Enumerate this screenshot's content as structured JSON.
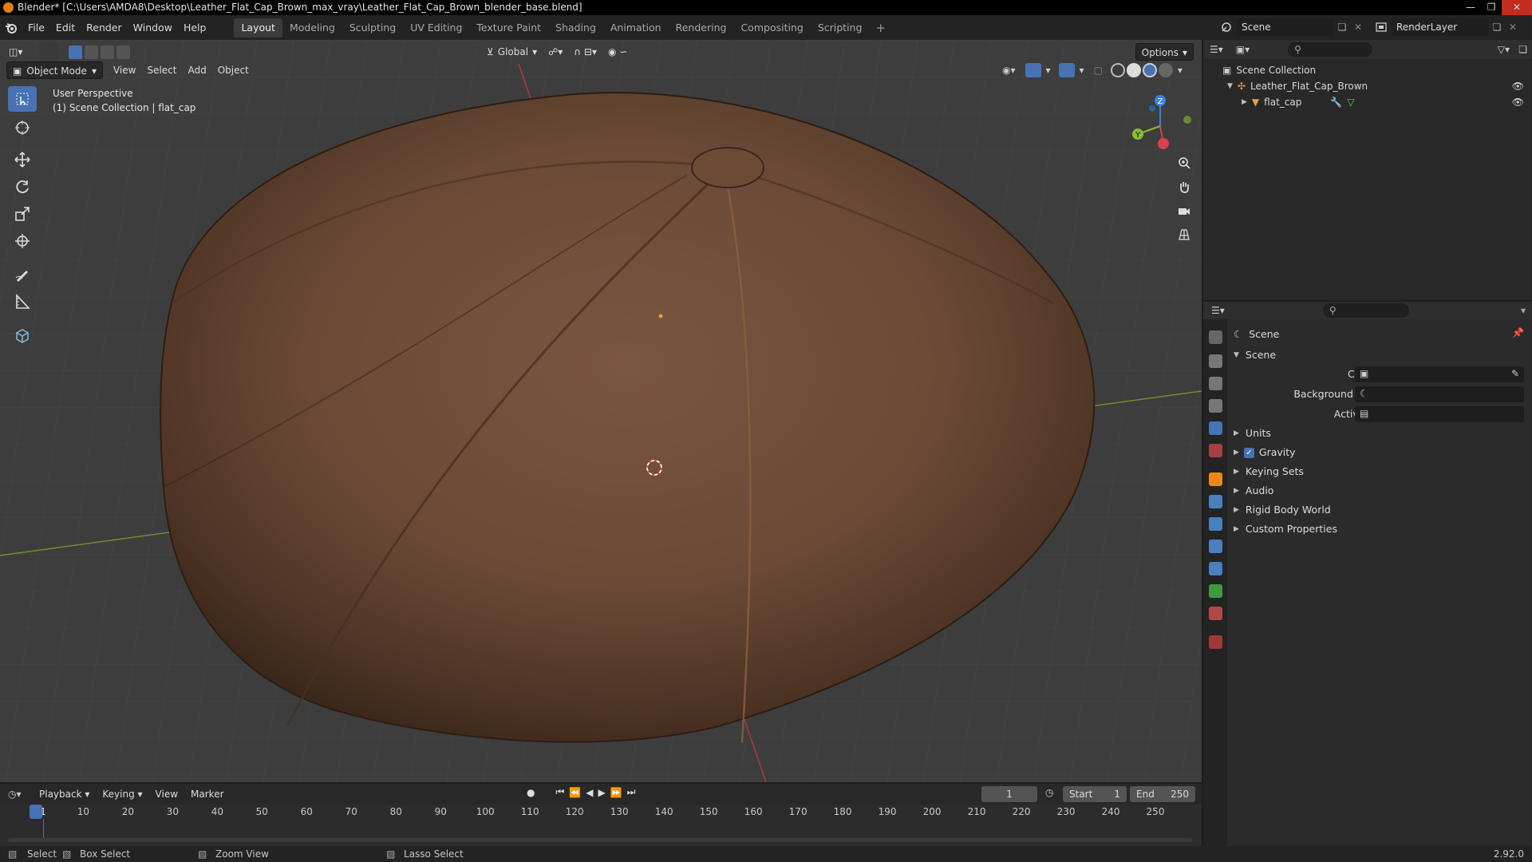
{
  "window": {
    "title": "Blender* [C:\\Users\\AMDA8\\Desktop\\Leather_Flat_Cap_Brown_max_vray\\Leather_Flat_Cap_Brown_blender_base.blend]"
  },
  "menu": [
    "File",
    "Edit",
    "Render",
    "Window",
    "Help"
  ],
  "workspaces": [
    "Layout",
    "Modeling",
    "Sculpting",
    "UV Editing",
    "Texture Paint",
    "Shading",
    "Animation",
    "Rendering",
    "Compositing",
    "Scripting"
  ],
  "workspace_add": "+",
  "scene_selector": {
    "scene": "Scene",
    "view_layer": "RenderLayer"
  },
  "viewport": {
    "mode": "Object Mode",
    "menus": [
      "View",
      "Select",
      "Add",
      "Object"
    ],
    "orientation": "Global",
    "options_label": "Options",
    "overlay_line1": "User Perspective",
    "overlay_line2": "(1) Scene Collection | flat_cap",
    "gizmo": {
      "x": "X",
      "y": "Y",
      "z": "Z"
    }
  },
  "outliner": {
    "root": "Scene Collection",
    "collection": "Leather_Flat_Cap_Brown",
    "object": "flat_cap"
  },
  "properties": {
    "header": "Scene",
    "panel": "Scene",
    "fields": [
      {
        "label": "Camera",
        "value": ""
      },
      {
        "label": "Background Scene",
        "value": ""
      },
      {
        "label": "Active Clip",
        "value": ""
      }
    ],
    "subpanels": [
      "Units",
      "Gravity",
      "Keying Sets",
      "Audio",
      "Rigid Body World",
      "Custom Properties"
    ],
    "gravity_checked": true
  },
  "timeline": {
    "menus": [
      "Playback",
      "Keying",
      "View",
      "Marker"
    ],
    "current_frame": "1",
    "start_label": "Start",
    "start": "1",
    "end_label": "End",
    "end": "250",
    "ticks": [
      "1",
      "10",
      "20",
      "30",
      "40",
      "50",
      "60",
      "70",
      "80",
      "90",
      "100",
      "110",
      "120",
      "130",
      "140",
      "150",
      "160",
      "170",
      "180",
      "190",
      "200",
      "210",
      "220",
      "230",
      "240",
      "250"
    ]
  },
  "statusbar": {
    "select": "Select",
    "box_select": "Box Select",
    "zoom": "Zoom View",
    "lasso": "Lasso Select",
    "version": "2.92.0"
  },
  "colors": {
    "accent": "#4772b3",
    "x_axis": "#d9414e",
    "y_axis": "#8bbd2c",
    "z_axis": "#3d82e0",
    "object_origin": "#f0a030"
  }
}
